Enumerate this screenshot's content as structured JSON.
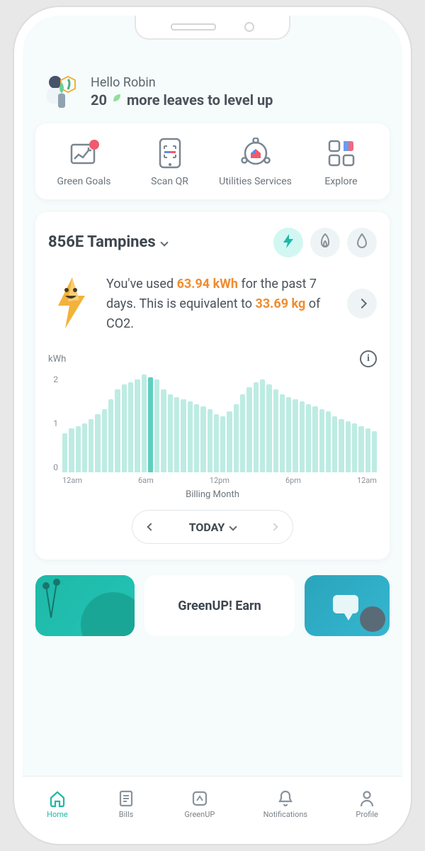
{
  "greeting": {
    "hello_prefix": "Hello",
    "user_name": "Robin",
    "leaves_count": "20",
    "level_up_text": "more leaves to level up"
  },
  "quick_actions": [
    {
      "label": "Green Goals",
      "icon": "chart-badge-icon"
    },
    {
      "label": "Scan QR",
      "icon": "qr-scan-icon"
    },
    {
      "label": "Utilities Services",
      "icon": "home-network-icon"
    },
    {
      "label": "Explore",
      "icon": "grid-icon"
    }
  ],
  "usage": {
    "location": "856E Tampines",
    "utilities": [
      {
        "name": "electricity",
        "active": true
      },
      {
        "name": "gas",
        "active": false
      },
      {
        "name": "water",
        "active": false
      }
    ],
    "summary": {
      "prefix": "You've used ",
      "value1": "63.94 kWh",
      "mid": " for the past 7 days. This is equivalent to ",
      "value2": "33.69 kg",
      "suffix": " of CO2."
    }
  },
  "chart_data": {
    "type": "bar",
    "title": "",
    "ylabel": "kWh",
    "xlabel": "Billing Month",
    "ylim": [
      0,
      2
    ],
    "y_ticks": [
      "2",
      "1",
      "0"
    ],
    "x_ticks": [
      "12am",
      "6am",
      "12pm",
      "6pm",
      "12am"
    ],
    "categories": [
      "0",
      "0.5",
      "1",
      "1.5",
      "2",
      "2.5",
      "3",
      "3.5",
      "4",
      "4.5",
      "5",
      "5.5",
      "6",
      "6.5",
      "7",
      "7.5",
      "8",
      "8.5",
      "9",
      "9.5",
      "10",
      "10.5",
      "11",
      "11.5",
      "12",
      "12.5",
      "13",
      "13.5",
      "14",
      "14.5",
      "15",
      "15.5",
      "16",
      "16.5",
      "17",
      "17.5",
      "18",
      "18.5",
      "19",
      "19.5",
      "20",
      "20.5",
      "21",
      "21.5",
      "22",
      "22.5",
      "23",
      "23.5"
    ],
    "values": [
      0.8,
      0.9,
      0.95,
      1.0,
      1.1,
      1.2,
      1.3,
      1.5,
      1.7,
      1.8,
      1.85,
      1.9,
      2.0,
      1.95,
      1.9,
      1.7,
      1.6,
      1.55,
      1.5,
      1.45,
      1.4,
      1.35,
      1.3,
      1.2,
      1.15,
      1.25,
      1.4,
      1.6,
      1.75,
      1.85,
      1.9,
      1.8,
      1.7,
      1.6,
      1.55,
      1.5,
      1.45,
      1.4,
      1.35,
      1.3,
      1.25,
      1.15,
      1.1,
      1.05,
      1.0,
      0.95,
      0.9,
      0.85
    ],
    "highlight_index": 13
  },
  "date_selector": {
    "label": "TODAY"
  },
  "promo": {
    "title": "GreenUP! Earn"
  },
  "tabs": [
    {
      "label": "Home",
      "icon": "home-icon",
      "active": true
    },
    {
      "label": "Bills",
      "icon": "bill-icon",
      "active": false
    },
    {
      "label": "GreenUP",
      "icon": "up-icon",
      "active": false
    },
    {
      "label": "Notifications",
      "icon": "bell-icon",
      "active": false
    },
    {
      "label": "Profile",
      "icon": "person-icon",
      "active": false
    }
  ]
}
